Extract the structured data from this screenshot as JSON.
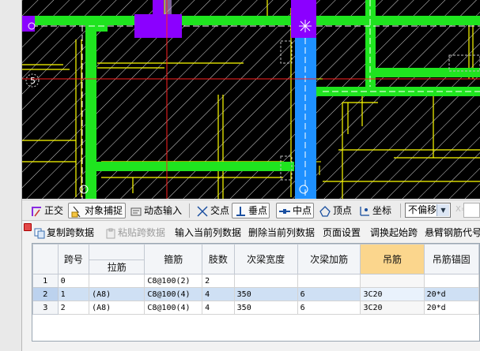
{
  "canvas": {
    "background": "#000000",
    "beam_color": "#1fe41f",
    "selected_beam_color": "#1e90ff",
    "column_color": "#8b00ff",
    "line_color": "#ffff00",
    "axis_label": "5"
  },
  "snapbar": {
    "ortho": "正交",
    "object_snap": "对象捕捉",
    "dynamic_input": "动态输入",
    "intersection": "交点",
    "perpendicular": "垂点",
    "midpoint": "中点",
    "vertex": "顶点",
    "coordinate": "坐标",
    "offset": "不偏移",
    "x_label": "X="
  },
  "toolbar": {
    "copy_span": "复制跨数据",
    "paste_span": "粘贴跨数据",
    "input_column": "输入当前列数据",
    "delete_column": "删除当前列数据",
    "page_setup": "页面设置",
    "swap_start": "调换起始跨",
    "cantilever": "悬臂钢筋代号"
  },
  "table": {
    "headers": [
      "跨号",
      "拉筋",
      "箍筋",
      "肢数",
      "次梁宽度",
      "次梁加筋",
      "吊筋",
      "吊筋锚固"
    ],
    "rows": [
      {
        "num": "1",
        "span": "0",
        "tie": "",
        "stirrup": "C8@100(2)",
        "legs": "2",
        "width": "",
        "add": "",
        "hanger": "",
        "anchor": ""
      },
      {
        "num": "2",
        "span": "1",
        "tie": "(A8)",
        "stirrup": "C8@100(4)",
        "legs": "4",
        "width": "350",
        "add": "6",
        "hanger": "3C20",
        "anchor": "20*d"
      },
      {
        "num": "3",
        "span": "2",
        "tie": "(A8)",
        "stirrup": "C8@100(4)",
        "legs": "4",
        "width": "350",
        "add": "6",
        "hanger": "3C20",
        "anchor": "20*d"
      }
    ]
  }
}
